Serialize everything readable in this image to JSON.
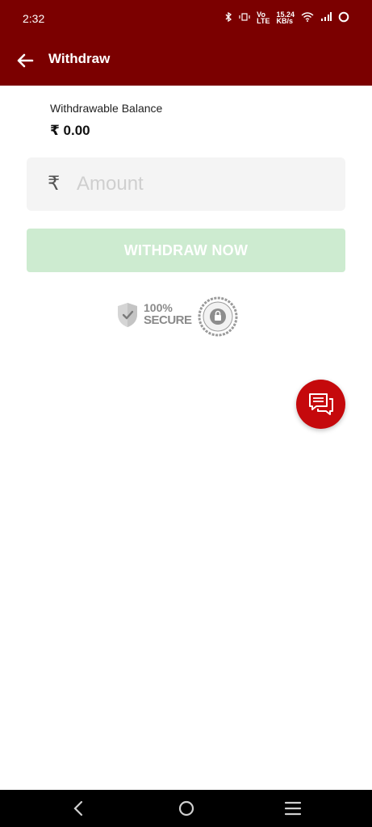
{
  "status_bar": {
    "time": "2:32",
    "network_speed": "15.24\nKB/s",
    "volte": "Vo\nLTE"
  },
  "app_bar": {
    "title": "Withdraw"
  },
  "balance": {
    "label": "Withdrawable Balance",
    "value": "₹ 0.00"
  },
  "amount_field": {
    "currency_symbol": "₹",
    "placeholder": "Amount",
    "value": ""
  },
  "withdraw_button": {
    "label": "WITHDRAW NOW",
    "color": "#cdebd0"
  },
  "secure_badge": {
    "percent": "100%",
    "word": "SECURE"
  },
  "colors": {
    "primary": "#7b0000",
    "fab": "#c5090c"
  }
}
